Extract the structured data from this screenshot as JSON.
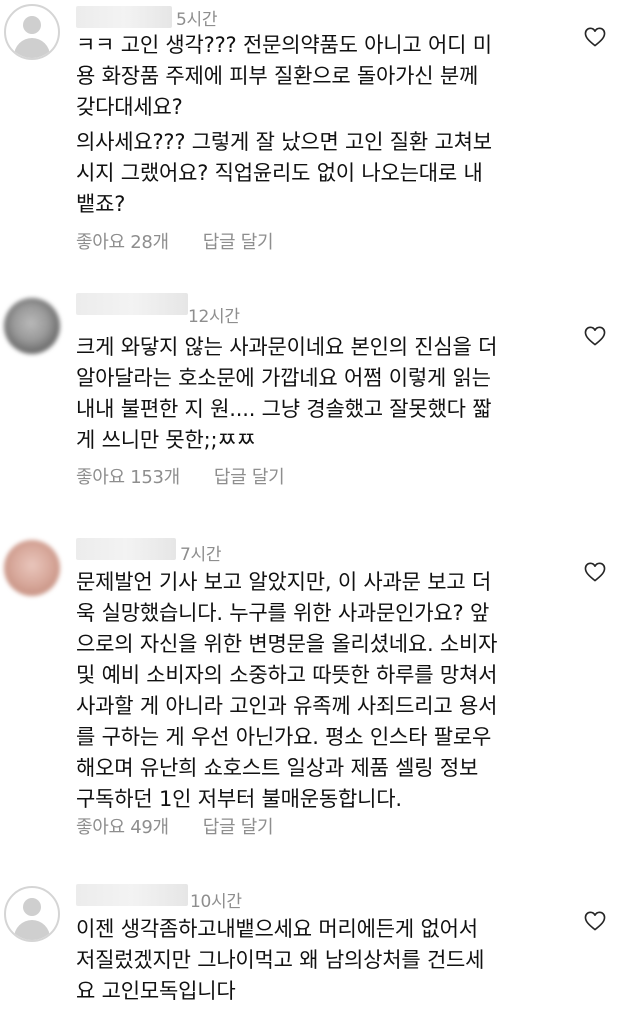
{
  "comments": [
    {
      "time": "5시간",
      "paragraphs": [
        "ㅋㅋ 고인 생각??? 전문의약품도 아니고 어디 미\n용 화장품 주제에 피부 질환으로 돌아가신 분께\n갖다대세요?",
        "의사세요??? 그렇게 잘 났으면 고인 질환 고쳐보\n시지 그랬어요? 직업윤리도 없이 나오는대로 내\n뱉죠?"
      ],
      "likes": "좋아요 28개",
      "reply": "답글 달기",
      "avatar": "default-avatar"
    },
    {
      "time": "12시간",
      "paragraphs": [
        "크게 와닿지 않는 사과문이네요 본인의 진심을 더\n알아달라는 호소문에 가깝네요 어쩜 이렇게 읽는\n내내 불편한 지 원.... 그냥 경솔했고 잘못했다 짧\n게 쓰니만 못한;;ㅉㅉ"
      ],
      "likes": "좋아요 153개",
      "reply": "답글 달기",
      "avatar": "blurred-photo"
    },
    {
      "time": "7시간",
      "paragraphs": [
        "문제발언 기사 보고 알았지만, 이 사과문 보고 더\n욱 실망했습니다. 누구를 위한 사과문인가요? 앞\n으로의 자신을 위한 변명문을 올리셨네요. 소비자\n및 예비 소비자의 소중하고 따뜻한 하루를 망쳐서\n사과할 게 아니라 고인과 유족께 사죄드리고 용서\n를 구하는 게 우선 아닌가요. 평소 인스타 팔로우\n해오며 유난희 쇼호스트 일상과 제품 셀링 정보\n구독하던 1인 저부터 불매운동합니다."
      ],
      "likes": "좋아요 49개",
      "reply": "답글 달기",
      "avatar": "blurred-photo"
    },
    {
      "time": "10시간",
      "paragraphs": [
        "이젠  생각좀하고내뱉으세요 머리에든게 없어서\n저질렀겠지만 그나이먹고 왜 남의상처를 건드세\n요 고인모독입니다"
      ],
      "avatar": "default-avatar"
    }
  ],
  "colors": {
    "text": "#111111",
    "meta": "#8e8e8e",
    "heart_stroke": "#262626"
  },
  "icons": {
    "like": "heart-outline-icon"
  }
}
